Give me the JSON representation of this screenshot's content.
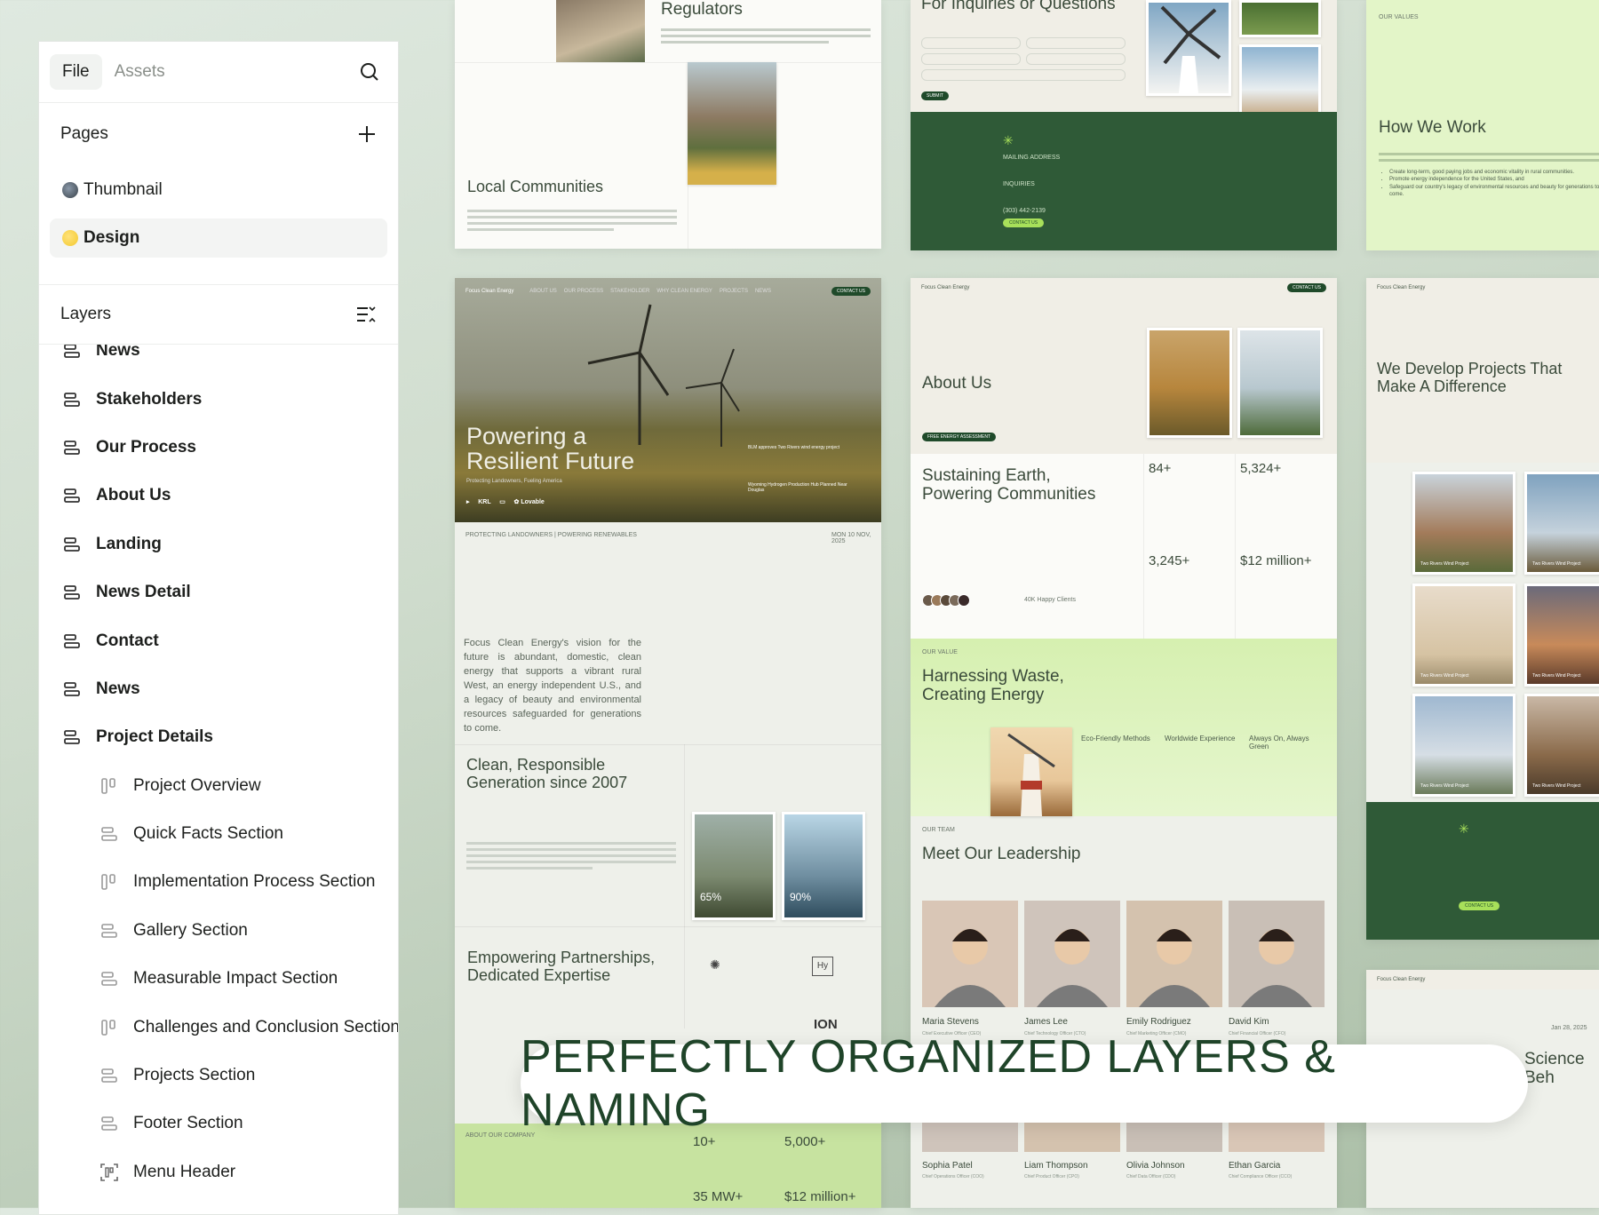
{
  "panel": {
    "tabs": [
      "File",
      "Assets"
    ],
    "pages_title": "Pages",
    "pages": [
      {
        "label": "Thumbnail",
        "color": "#39424a"
      },
      {
        "label": "Design",
        "color": "#f3c92f"
      }
    ],
    "layers_title": "Layers",
    "layers": [
      {
        "label": "News",
        "level": "top"
      },
      {
        "label": "Stakeholders",
        "level": "top"
      },
      {
        "label": "Our Process",
        "level": "top"
      },
      {
        "label": "About Us",
        "level": "top"
      },
      {
        "label": "Landing",
        "level": "top"
      },
      {
        "label": "News Detail",
        "level": "top"
      },
      {
        "label": "Contact",
        "level": "top"
      },
      {
        "label": "News",
        "level": "top"
      },
      {
        "label": "Project Details",
        "level": "top"
      },
      {
        "label": "Project Overview",
        "level": "child"
      },
      {
        "label": "Quick Facts Section",
        "level": "child"
      },
      {
        "label": "Implementation Process Section",
        "level": "child"
      },
      {
        "label": "Gallery Section",
        "level": "child"
      },
      {
        "label": "Measurable Impact Section",
        "level": "child"
      },
      {
        "label": "Challenges and Conclusion Section",
        "level": "child"
      },
      {
        "label": "Projects Section",
        "level": "child"
      },
      {
        "label": "Footer Section",
        "level": "child"
      },
      {
        "label": "Menu Header",
        "level": "child"
      }
    ]
  },
  "boards": {
    "regulators": {
      "title": "Regulators",
      "local": "Local Communities"
    },
    "inquiries": {
      "title": "For Inquiries or Questions",
      "mailing": "MAILING ADDRESS",
      "inquiries": "INQUIRIES",
      "phone": "(303) 442-2139",
      "contact": "CONTACT US"
    },
    "values": {
      "kicker": "OUR VALUES",
      "title": "How We Work",
      "bullets": [
        "Create long-term, good paying jobs and economic vitality in rural communities.",
        "Promote energy independence for the United States, and",
        "Safeguard our country's legacy of environmental resources and beauty for generations to come."
      ]
    },
    "landing": {
      "brand": "Focus Clean Energy",
      "nav": [
        "ABOUT US",
        "OUR PROCESS",
        "STAKEHOLDER",
        "WHY CLEAN ENERGY",
        "PROJECTS",
        "NEWS"
      ],
      "cta": "CONTACT US",
      "hero1": "Powering a",
      "hero2": "Resilient Future",
      "hero_sub": "Protecting Landowners, Fueling America",
      "news1": "BLM approves Two Rivers wind energy project",
      "news2": "Wyoming Hydrogen Production Hub Planned Near Douglas",
      "logo_lovable": "Lovable",
      "strip_left": "PROTECTING LANDOWNERS | POWERING RENEWABLES",
      "strip_right": "MON 10 NOV, 2025",
      "vision": "Focus Clean Energy's vision for the future is abundant, domestic, clean energy that supports a vibrant rural West, an energy independent U.S., and a legacy of beauty and environmental resources safeguarded for generations to come.",
      "clean1": "Clean, Responsible",
      "clean2": "Generation since 2007",
      "pct1": "65%",
      "pct2": "90%",
      "emp1": "Empowering Partnerships,",
      "emp2": "Dedicated Expertise",
      "logo_hy": "Hy",
      "logo_ion": "ION",
      "about_small": "ABOUT OUR COMPANY",
      "s1": "10+",
      "s2": "5,000+",
      "s3": "35 MW+",
      "s4": "$12 million+"
    },
    "about": {
      "brand": "Focus Clean Energy",
      "title": "About Us",
      "sus1": "Sustaining Earth,",
      "sus2": "Powering Communities",
      "stat1": "84+",
      "stat2": "5,324+",
      "stat3": "3,245+",
      "stat4": "$12 million+",
      "happy": "40K Happy Clients",
      "kicker": "OUR VALUE",
      "harv1": "Harnessing Waste,",
      "harv2": "Creating Energy",
      "f1": "Eco-Friendly Methods",
      "f2": "Worldwide Experience",
      "f3": "Always On, Always Green",
      "team_kicker": "OUR TEAM",
      "team_title": "Meet Our Leadership",
      "team": [
        {
          "name": "Maria Stevens",
          "role": "Chief Executive Officer (CEO)"
        },
        {
          "name": "James Lee",
          "role": "Chief Technology Officer (CTO)"
        },
        {
          "name": "Emily Rodriguez",
          "role": "Chief Marketing Officer (CMO)"
        },
        {
          "name": "David Kim",
          "role": "Chief Financial Officer (CFO)"
        }
      ],
      "team2": [
        {
          "name": "Sophia Patel",
          "role": "Chief Operations Officer (COO)"
        },
        {
          "name": "Liam Thompson",
          "role": "Chief Product Officer (CPO)"
        },
        {
          "name": "Olivia Johnson",
          "role": "Chief Data Officer (CDO)"
        },
        {
          "name": "Ethan Garcia",
          "role": "Chief Compliance Officer (CCO)"
        }
      ]
    },
    "projects": {
      "brand": "Focus Clean Energy",
      "title1": "We Develop Projects That",
      "title2": "Make A Difference",
      "card": "Two Rivers Wind Project",
      "date": "Jan 28, 2025",
      "science": "Science Beh"
    }
  },
  "banner": "PERFECTLY ORGANIZED LAYERS & NAMING"
}
